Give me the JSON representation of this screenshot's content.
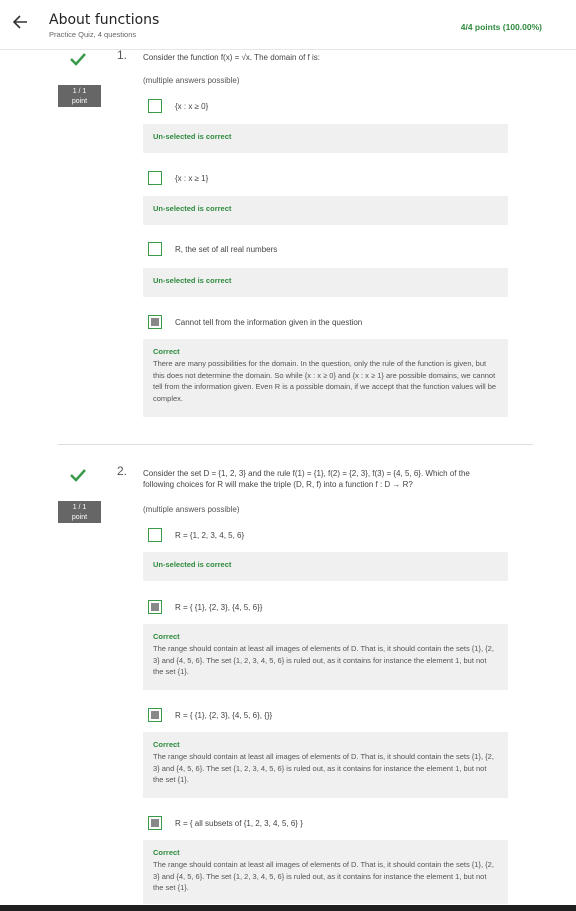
{
  "header": {
    "title": "About functions",
    "subtitle": "Practice Quiz, 4 questions",
    "score": "4/4 points (100.00%)"
  },
  "questions": [
    {
      "number": "1.",
      "points_line1": "1 / 1",
      "points_line2": "point",
      "text": "Consider the function f(x) = √x. The domain of f is:",
      "hint": "(multiple answers possible)",
      "options": [
        {
          "label": "{x : x ≥ 0}",
          "checked": false,
          "status": "Un-selected is correct",
          "feedback": ""
        },
        {
          "label": "{x : x ≥ 1}",
          "checked": false,
          "status": "Un-selected is correct",
          "feedback": ""
        },
        {
          "label": "R, the set of all real numbers",
          "checked": false,
          "status": "Un-selected is correct",
          "feedback": ""
        },
        {
          "label": "Cannot tell from the information given in the question",
          "checked": true,
          "status": "Correct",
          "feedback": "There are many possibilities for the domain. In the question, only the rule of the function is given, but this does not determine the domain. So while {x : x ≥ 0} and {x : x ≥ 1} are possible domains, we cannot tell from the information given. Even R is a possible domain, if we accept that the function values will be complex."
        }
      ]
    },
    {
      "number": "2.",
      "points_line1": "1 / 1",
      "points_line2": "point",
      "text": "Consider the set D = {1, 2, 3} and the rule f(1) = {1}, f(2) = {2, 3}, f(3) = {4, 5, 6}. Which of the following choices for R will make the triple (D, R, f) into a function f : D → R?",
      "hint": "(multiple answers possible)",
      "options": [
        {
          "label": "R = {1, 2, 3, 4, 5, 6}",
          "checked": false,
          "status": "Un-selected is correct",
          "feedback": ""
        },
        {
          "label": "R = { {1}, {2, 3}, {4, 5, 6}}",
          "checked": true,
          "status": "Correct",
          "feedback": "The range should contain at least all images of elements of D. That is, it should contain the sets {1}, {2, 3} and {4, 5, 6}. The set {1, 2, 3, 4, 5, 6} is ruled out, as it contains for instance the element 1, but not the set {1}."
        },
        {
          "label": "R = { {1}, {2, 3}, {4, 5, 6}, {}}",
          "checked": true,
          "status": "Correct",
          "feedback": "The range should contain at least all images of elements of D. That is, it should contain the sets {1}, {2, 3} and {4, 5, 6}. The set {1, 2, 3, 4, 5, 6} is ruled out, as it contains for instance the element 1, but not the set {1}."
        },
        {
          "label": "R = { all subsets of {1, 2, 3, 4, 5, 6} }",
          "checked": true,
          "status": "Correct",
          "feedback": "The range should contain at least all images of elements of D. That is, it should contain the sets {1}, {2, 3} and {4, 5, 6}. The set {1, 2, 3, 4, 5, 6} is ruled out, as it contains for instance the element 1, but not the set {1}."
        }
      ]
    }
  ],
  "icons": {
    "back": "arrow-left-icon",
    "correct": "check-icon"
  },
  "colors": {
    "correct_green": "#2e8b3e",
    "points_badge": "#666666",
    "feedback_bg": "#f0f0f0"
  }
}
